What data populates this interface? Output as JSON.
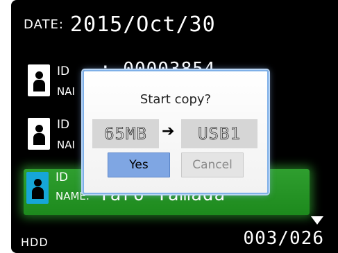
{
  "header": {
    "date_label": "DATE:",
    "date_value": "2015/Oct/30"
  },
  "records": [
    {
      "id_label": "ID",
      "id_value": ": 00003854",
      "name_label": "NAI",
      "name_value": "",
      "selected": false
    },
    {
      "id_label": "ID",
      "id_value": "",
      "name_label": "NAI",
      "name_value": "",
      "selected": false
    },
    {
      "id_label": "ID",
      "id_value": "",
      "name_label": "NAME:",
      "name_value": "Taro Yamada",
      "selected": true
    }
  ],
  "footer": {
    "media": "HDD",
    "counter": "003/026"
  },
  "dialog": {
    "title": "Start copy?",
    "size": "65MB",
    "arrow": "➔",
    "destination": "USB1",
    "yes_label": "Yes",
    "cancel_label": "Cancel"
  },
  "colors": {
    "selected_row": "#1d8a1d",
    "selected_icon": "#16a6d8",
    "yes_button": "#7fa6e3"
  },
  "icons": {
    "record_icon": "person-icon",
    "scroll": "down-triangle-icon"
  }
}
